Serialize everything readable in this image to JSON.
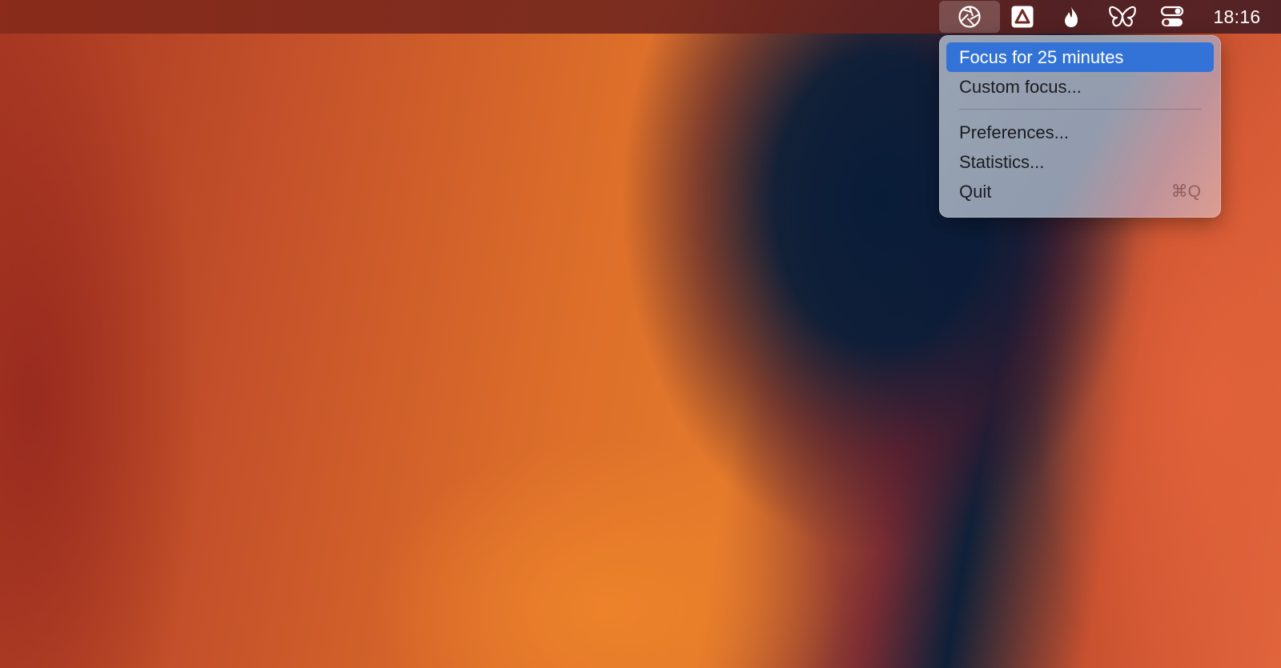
{
  "menubar": {
    "clock": "18:16",
    "status_icons": [
      "aperture-focus-icon",
      "drive-triangle-icon",
      "flame-icon",
      "butterfly-icon",
      "control-center-toggles-icon"
    ]
  },
  "menu": {
    "items": [
      {
        "label": "Focus for 25 minutes",
        "highlighted": true
      },
      {
        "label": "Custom focus..."
      },
      {
        "label": "Preferences..."
      },
      {
        "label": "Statistics..."
      },
      {
        "label": "Quit",
        "shortcut": "⌘Q"
      }
    ]
  },
  "colors": {
    "highlight": "#3372d6",
    "menu_text": "#1b1b1f"
  }
}
